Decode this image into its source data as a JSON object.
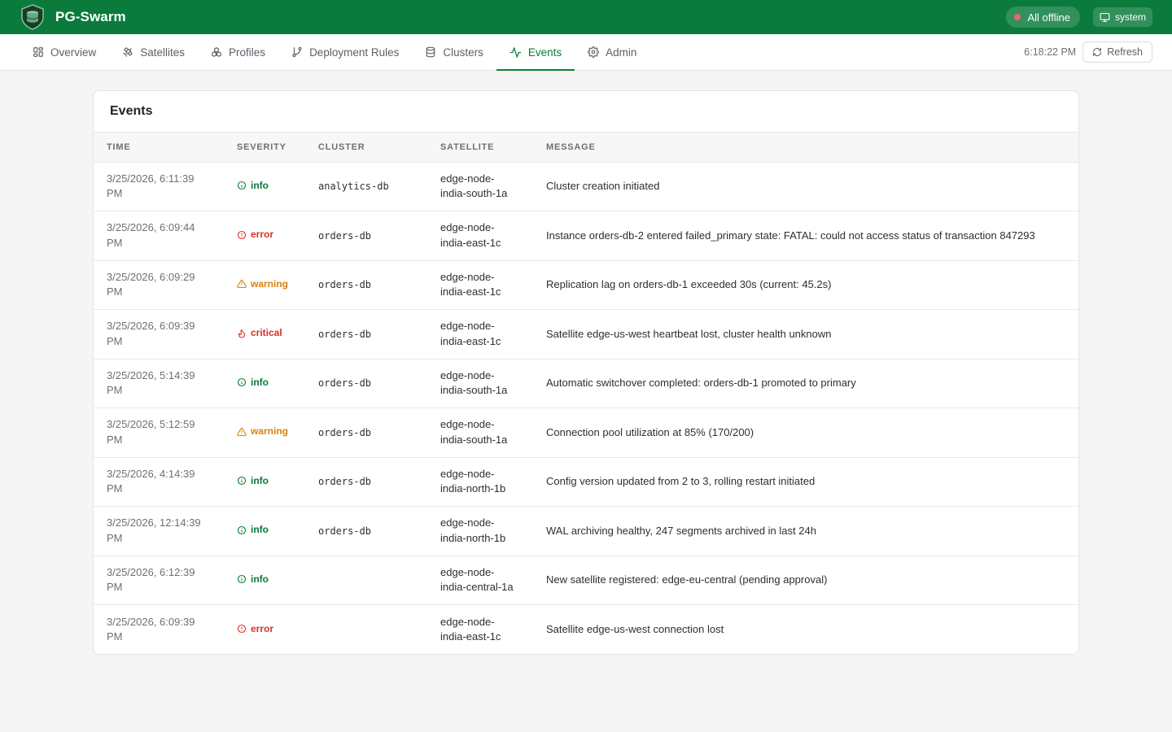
{
  "app": {
    "title": "PG-Swarm",
    "status_label": "All offline",
    "user_label": "system"
  },
  "nav": {
    "tabs": [
      {
        "label": "Overview",
        "icon": "grid-icon",
        "active": false
      },
      {
        "label": "Satellites",
        "icon": "satellite-icon",
        "active": false
      },
      {
        "label": "Profiles",
        "icon": "boxes-icon",
        "active": false
      },
      {
        "label": "Deployment Rules",
        "icon": "git-branch-icon",
        "active": false
      },
      {
        "label": "Clusters",
        "icon": "database-icon",
        "active": false
      },
      {
        "label": "Events",
        "icon": "activity-icon",
        "active": true
      },
      {
        "label": "Admin",
        "icon": "gear-icon",
        "active": false
      }
    ],
    "clock": "6:18:22 PM",
    "refresh_label": "Refresh"
  },
  "events": {
    "title": "Events",
    "columns": [
      "TIME",
      "SEVERITY",
      "CLUSTER",
      "SATELLITE",
      "MESSAGE"
    ],
    "rows": [
      {
        "time": "3/25/2026, 6:11:39 PM",
        "severity": "info",
        "cluster": "analytics-db",
        "satellite": "edge-node-india-south-1a",
        "message": "Cluster creation initiated"
      },
      {
        "time": "3/25/2026, 6:09:44 PM",
        "severity": "error",
        "cluster": "orders-db",
        "satellite": "edge-node-india-east-1c",
        "message": "Instance orders-db-2 entered failed_primary state: FATAL: could not access status of transaction 847293"
      },
      {
        "time": "3/25/2026, 6:09:29 PM",
        "severity": "warning",
        "cluster": "orders-db",
        "satellite": "edge-node-india-east-1c",
        "message": "Replication lag on orders-db-1 exceeded 30s (current: 45.2s)"
      },
      {
        "time": "3/25/2026, 6:09:39 PM",
        "severity": "critical",
        "cluster": "orders-db",
        "satellite": "edge-node-india-east-1c",
        "message": "Satellite edge-us-west heartbeat lost, cluster health unknown"
      },
      {
        "time": "3/25/2026, 5:14:39 PM",
        "severity": "info",
        "cluster": "orders-db",
        "satellite": "edge-node-india-south-1a",
        "message": "Automatic switchover completed: orders-db-1 promoted to primary"
      },
      {
        "time": "3/25/2026, 5:12:59 PM",
        "severity": "warning",
        "cluster": "orders-db",
        "satellite": "edge-node-india-south-1a",
        "message": "Connection pool utilization at 85% (170/200)"
      },
      {
        "time": "3/25/2026, 4:14:39 PM",
        "severity": "info",
        "cluster": "orders-db",
        "satellite": "edge-node-india-north-1b",
        "message": "Config version updated from 2 to 3, rolling restart initiated"
      },
      {
        "time": "3/25/2026, 12:14:39 PM",
        "severity": "info",
        "cluster": "orders-db",
        "satellite": "edge-node-india-north-1b",
        "message": "WAL archiving healthy, 247 segments archived in last 24h"
      },
      {
        "time": "3/25/2026, 6:12:39 PM",
        "severity": "info",
        "cluster": "",
        "satellite": "edge-node-india-central-1a",
        "message": "New satellite registered: edge-eu-central (pending approval)"
      },
      {
        "time": "3/25/2026, 6:09:39 PM",
        "severity": "error",
        "cluster": "",
        "satellite": "edge-node-india-east-1c",
        "message": "Satellite edge-us-west connection lost"
      }
    ]
  },
  "colors": {
    "brand": "#0a7b3c",
    "info": "#0a7b3c",
    "error": "#d93025",
    "warning": "#d9820b",
    "critical": "#d93025",
    "offline_dot": "#f0666a"
  }
}
